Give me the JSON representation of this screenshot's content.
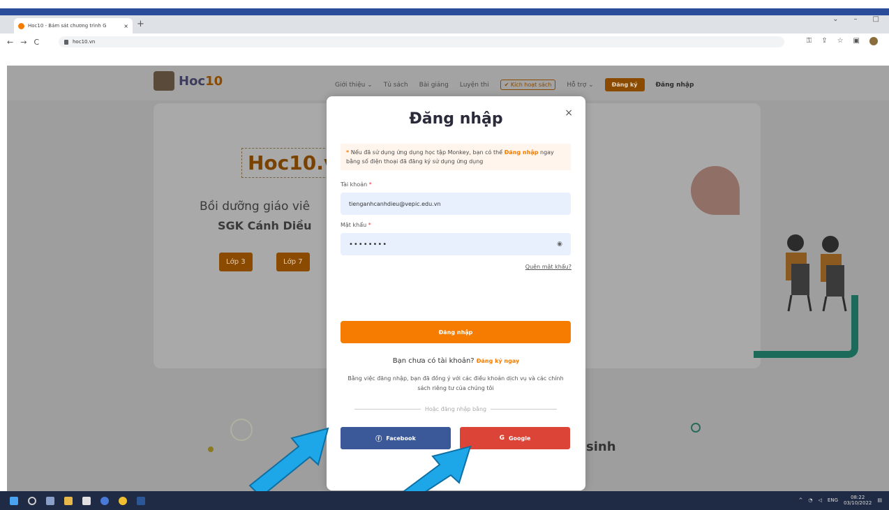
{
  "browser": {
    "tab_title": "Hoc10 - Bám sát chương trình G",
    "tab_close": "×",
    "new_tab": "+",
    "url": "hoc10.vn",
    "back": "←",
    "forward": "→",
    "reload": "C",
    "window_controls": [
      "⌄",
      "–",
      "□"
    ]
  },
  "site": {
    "logo_text_main": "Hoc",
    "logo_text_num": "10",
    "nav": {
      "gioi_thieu": "Giới thiệu ⌄",
      "tu_sach": "Tủ sách",
      "bai_giang": "Bài giảng",
      "luyen_thi": "Luyện thi",
      "kich_hoat": "✔ Kích hoạt sách",
      "ho_tro": "Hỗ trợ ⌄",
      "dang_ky": "Đăng ký",
      "dang_nhap": "Đăng nhập"
    },
    "hero": {
      "title": "Hoc10.v",
      "subtitle": "Bồi dưỡng giáo viê",
      "subtitle2": "SGK Cánh Diều",
      "btn_lop3": "Lớp 3",
      "btn_lop7": "Lớp 7"
    },
    "bottom_word": "sinh"
  },
  "modal": {
    "title": "Đăng nhập",
    "close": "×",
    "notice_star": "*",
    "notice_text": " Nếu đã sử dụng ứng dụng học tập Monkey, bạn có thể ",
    "notice_link": "Đăng nhập",
    "notice_text2": " ngay bằng số điện thoại đã đăng ký sử dụng ứng dụng",
    "account_label": "Tài khoản",
    "account_value": "tienganhcanhdieu@vepic.edu.vn",
    "password_label": "Mật khẩu",
    "required_mark": "*",
    "password_value": "••••••••",
    "forgot": "Quên mật khẩu?",
    "submit": "Đăng nhập",
    "no_account": "Bạn chưa có tài khoản?",
    "register_link": "Đăng ký ngay",
    "terms": "Bằng việc đăng nhập, bạn đã đồng ý với các điều khoản dịch vụ và các chính sách riêng tư của chúng tôi",
    "divider": "Hoặc đăng nhập bằng",
    "facebook": "Facebook",
    "google": "Google"
  },
  "taskbar": {
    "lang": "ENG",
    "time": "08:22",
    "date": "03/10/2022"
  },
  "colors": {
    "brand_orange": "#f57c00",
    "facebook_blue": "#3b5998",
    "google_red": "#db4437",
    "arrow_blue": "#1ea7e8"
  }
}
